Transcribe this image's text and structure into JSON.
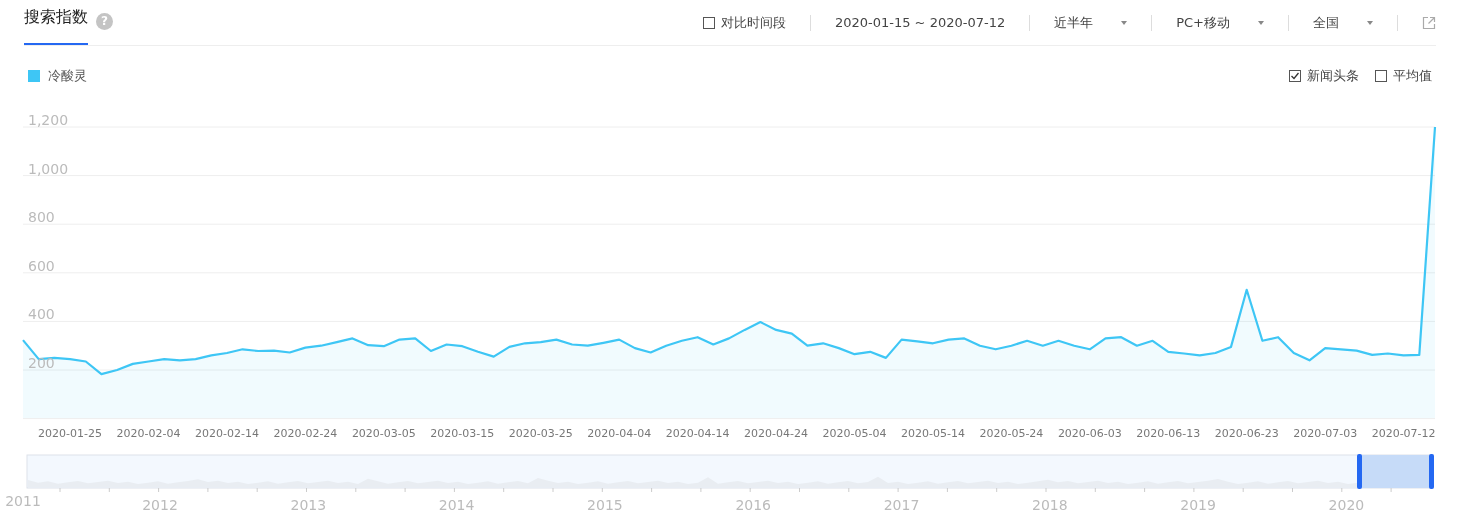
{
  "header": {
    "title": "搜索指数",
    "help": "?",
    "compare": {
      "label": "对比时间段",
      "checked": false
    },
    "date_range": "2020-01-15 ~ 2020-07-12",
    "dropdowns": [
      {
        "label": "近半年"
      },
      {
        "label": "PC+移动"
      },
      {
        "label": "全国"
      }
    ]
  },
  "legend": {
    "toggles": [
      {
        "label": "新闻头条",
        "checked": true
      },
      {
        "label": "平均值",
        "checked": false
      }
    ]
  },
  "chart": {
    "chart_data": {
      "type": "area",
      "categories": [
        null,
        null,
        null,
        "2020-01-25",
        null,
        null,
        null,
        null,
        "2020-02-04",
        null,
        null,
        null,
        null,
        "2020-02-14",
        null,
        null,
        null,
        null,
        "2020-02-24",
        null,
        null,
        null,
        null,
        "2020-03-05",
        null,
        null,
        null,
        null,
        "2020-03-15",
        null,
        null,
        null,
        null,
        "2020-03-25",
        null,
        null,
        null,
        null,
        "2020-04-04",
        null,
        null,
        null,
        null,
        "2020-04-14",
        null,
        null,
        null,
        null,
        "2020-04-24",
        null,
        null,
        null,
        null,
        "2020-05-04",
        null,
        null,
        null,
        null,
        "2020-05-14",
        null,
        null,
        null,
        null,
        "2020-05-24",
        null,
        null,
        null,
        null,
        "2020-06-03",
        null,
        null,
        null,
        null,
        "2020-06-13",
        null,
        null,
        null,
        null,
        "2020-06-23",
        null,
        null,
        null,
        null,
        "2020-07-03",
        null,
        null,
        null,
        null,
        "2020-07-12",
        null,
        null
      ],
      "series": [
        {
          "name": "冷酸灵",
          "color": "#3ec6f5",
          "values": [
            323,
            245,
            250,
            245,
            235,
            183,
            200,
            225,
            235,
            245,
            240,
            245,
            260,
            270,
            285,
            278,
            280,
            272,
            292,
            300,
            315,
            330,
            302,
            298,
            325,
            330,
            278,
            305,
            298,
            275,
            255,
            295,
            310,
            315,
            325,
            305,
            300,
            312,
            325,
            290,
            272,
            300,
            320,
            335,
            305,
            330,
            365,
            397,
            365,
            350,
            300,
            310,
            290,
            265,
            275,
            250,
            325,
            318,
            310,
            325,
            330,
            300,
            285,
            300,
            320,
            300,
            320,
            300,
            285,
            330,
            335,
            300,
            320,
            275,
            268,
            260,
            270,
            295,
            530,
            320,
            335,
            270,
            240,
            290,
            285,
            280,
            262,
            268,
            260,
            262,
            1200
          ]
        }
      ],
      "ylim": [
        0,
        1200
      ],
      "yticks": [
        {
          "value": 200,
          "label": "200"
        },
        {
          "value": 400,
          "label": "400"
        },
        {
          "value": 600,
          "label": "600"
        },
        {
          "value": 800,
          "label": "800"
        },
        {
          "value": 1000,
          "label": "1,000"
        },
        {
          "value": 1200,
          "label": "1,200"
        }
      ],
      "grid": true
    }
  },
  "navigator": {
    "years": [
      "2011",
      "2012",
      "2013",
      "2014",
      "2015",
      "2016",
      "2017",
      "2018",
      "2019",
      "2020"
    ]
  }
}
